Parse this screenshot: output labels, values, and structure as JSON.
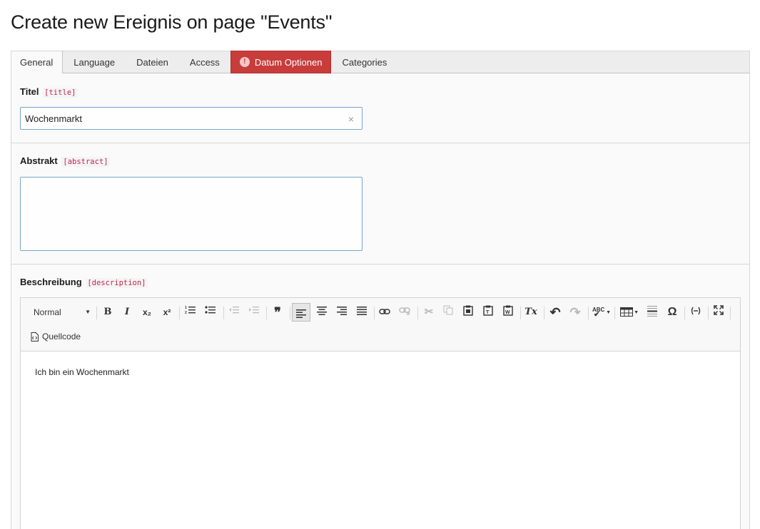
{
  "header": {
    "title": "Create new Ereignis on page \"Events\""
  },
  "tabs": [
    {
      "label": "General",
      "active": true
    },
    {
      "label": "Language"
    },
    {
      "label": "Dateien"
    },
    {
      "label": "Access"
    },
    {
      "label": "Datum Optionen",
      "error": true,
      "icon": "exclamation-icon",
      "icon_text": "!"
    },
    {
      "label": "Categories"
    }
  ],
  "fields": {
    "title": {
      "label": "Titel",
      "key": "[title]",
      "value": "Wochenmarkt",
      "clear": "×"
    },
    "abstract": {
      "label": "Abstrakt",
      "key": "[abstract]",
      "value": ""
    },
    "description": {
      "label": "Beschreibung",
      "key": "[description]",
      "value": "Ich bin ein Wochenmarkt"
    }
  },
  "editor": {
    "format_select": "Normal",
    "source_label": "Quellcode",
    "buttons": {
      "bold": "B",
      "italic": "I",
      "subscript": "x₂",
      "superscript": "x²",
      "blockquote": "❞",
      "clear_format": "Tx",
      "special_char": "Ω",
      "undo": "↶",
      "redo": "↷",
      "spellcheck": "ABC"
    }
  },
  "colors": {
    "error_tab": "#c83c3c",
    "code_key": "#c7254e",
    "input_focus": "#7aa5cc"
  }
}
